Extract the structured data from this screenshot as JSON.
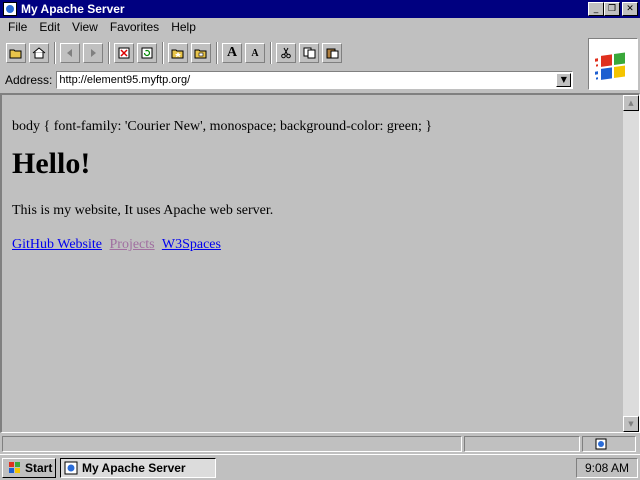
{
  "window": {
    "title": "My Apache Server",
    "controls": {
      "minimize": "_",
      "maximize": "❐",
      "close": "✕"
    }
  },
  "menu": [
    "File",
    "Edit",
    "View",
    "Favorites",
    "Help"
  ],
  "toolbar": {
    "font_larger": "A",
    "font_smaller": "A"
  },
  "address": {
    "label": "Address:",
    "url": "http://element95.myftp.org/"
  },
  "page": {
    "css_text": "body { font-family: 'Courier New', monospace; background-color: green; }",
    "heading": "Hello!",
    "paragraph": "This is my website, It uses Apache web server.",
    "links": [
      {
        "label": "GitHub Website",
        "visited": false
      },
      {
        "label": "Projects",
        "visited": true
      },
      {
        "label": "W3Spaces",
        "visited": false
      }
    ]
  },
  "taskbar": {
    "start_label": "Start",
    "task_label": "My Apache Server",
    "clock": "9:08 AM"
  },
  "colors": {
    "titlebar": "#000080",
    "link": "#0000ee",
    "visited_link": "#a06fa0"
  }
}
